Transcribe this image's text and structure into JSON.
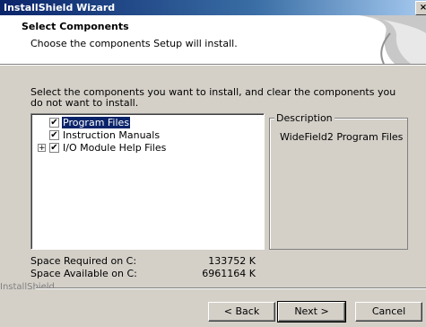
{
  "window": {
    "title": "InstallShield Wizard",
    "close_glyph": "×"
  },
  "header": {
    "title": "Select Components",
    "subtitle": "Choose the components Setup will install."
  },
  "instructions": "Select the components you want to install, and clear the components you do not want to install.",
  "tree": {
    "items": [
      {
        "label": "Program Files",
        "checked": true,
        "selected": true,
        "expandable": false
      },
      {
        "label": "Instruction Manuals",
        "checked": true,
        "selected": false,
        "expandable": false
      },
      {
        "label": "I/O Module Help Files",
        "checked": true,
        "selected": false,
        "expandable": true,
        "expander_glyph": "+"
      }
    ],
    "check_glyph": "✔"
  },
  "description": {
    "legend": "Description",
    "text": "WideField2 Program Files"
  },
  "space": {
    "required_label": "Space Required on  C:",
    "required_value": "133752 K",
    "available_label": "Space Available on  C:",
    "available_value": "6961164 K"
  },
  "footer": {
    "brand": "InstallShield"
  },
  "buttons": {
    "back": "< Back",
    "next": "Next >",
    "cancel": "Cancel"
  }
}
